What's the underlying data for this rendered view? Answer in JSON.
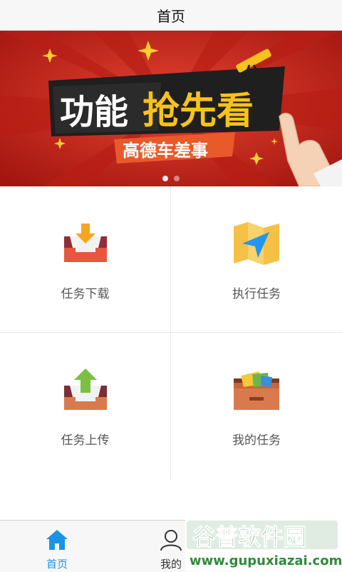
{
  "header": {
    "title": "首页"
  },
  "banner": {
    "headline_part1": "功能",
    "headline_part2": "抢先看",
    "subline": "高德车差事",
    "carousel_count": 2,
    "active_index": 0
  },
  "menu": {
    "items": [
      {
        "label": "任务下载",
        "icon": "tray-download-icon"
      },
      {
        "label": "执行任务",
        "icon": "map-navigation-icon"
      },
      {
        "label": "任务上传",
        "icon": "tray-upload-icon"
      },
      {
        "label": "我的任务",
        "icon": "drawer-folder-icon"
      }
    ]
  },
  "tabbar": {
    "tabs": [
      {
        "label": "首页",
        "icon": "home-icon",
        "active": true
      },
      {
        "label": "我的",
        "icon": "user-icon",
        "active": false
      }
    ]
  },
  "watermark": {
    "brand": "谷普软件园",
    "url": "www.gupuxiazai.com"
  },
  "colors": {
    "accent": "#1a94e6",
    "banner_red": "#c8281f",
    "banner_yellow": "#f7c21b"
  }
}
